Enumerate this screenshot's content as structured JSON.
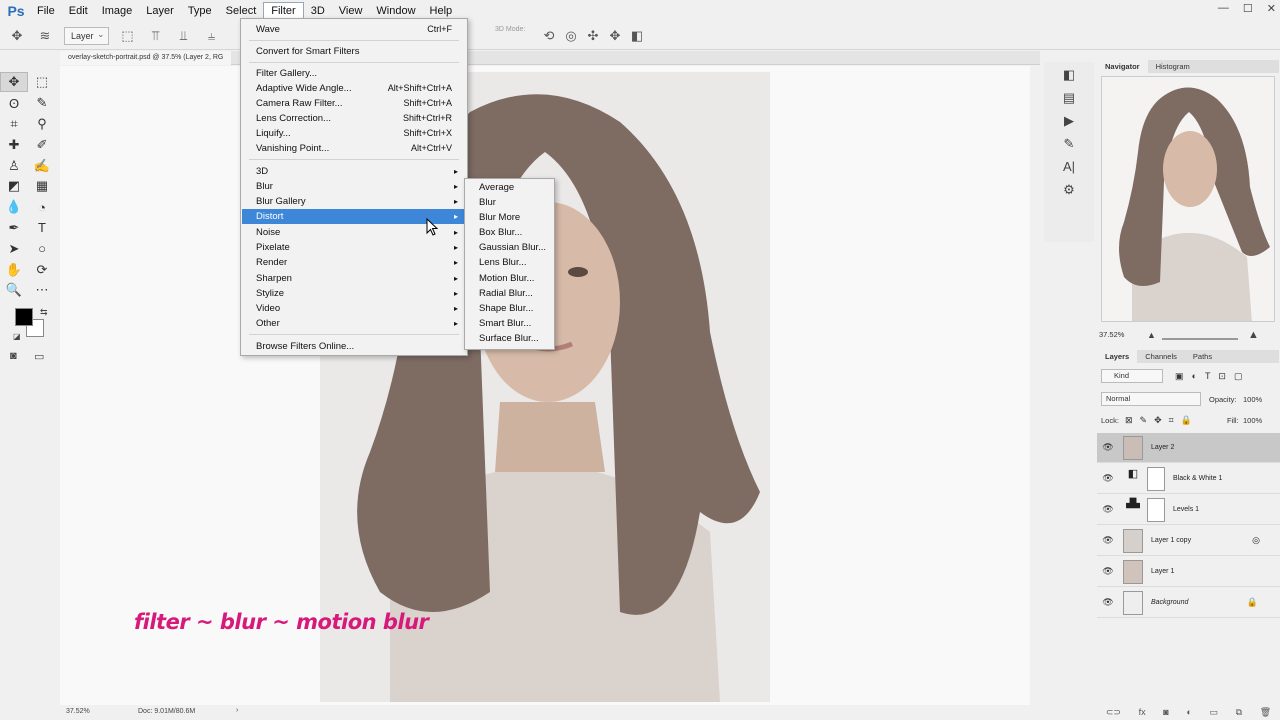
{
  "app": {
    "logo": "Ps"
  },
  "menubar": {
    "items": [
      "File",
      "Edit",
      "Image",
      "Layer",
      "Type",
      "Select",
      "Filter",
      "3D",
      "View",
      "Window",
      "Help"
    ],
    "active": "Filter"
  },
  "window_controls": [
    "—",
    "☐",
    "✕"
  ],
  "options_bar": {
    "layer_select": "Layer",
    "mode_3d": "3D Mode:"
  },
  "document": {
    "tab_title": "overlay-sketch-portrait.psd @ 37.5% (Layer 2, RG"
  },
  "status_bar": {
    "zoom": "37.52%",
    "doc_size": "Doc: 9.01M/80.6M"
  },
  "filter_menu": {
    "items": [
      {
        "label": "Wave",
        "shortcut": "Ctrl+F"
      },
      {
        "label": "Convert for Smart Filters",
        "shortcut": ""
      },
      {
        "label": "Filter Gallery...",
        "shortcut": ""
      },
      {
        "label": "Adaptive Wide Angle...",
        "shortcut": "Alt+Shift+Ctrl+A"
      },
      {
        "label": "Camera Raw Filter...",
        "shortcut": "Shift+Ctrl+A"
      },
      {
        "label": "Lens Correction...",
        "shortcut": "Shift+Ctrl+R"
      },
      {
        "label": "Liquify...",
        "shortcut": "Shift+Ctrl+X"
      },
      {
        "label": "Vanishing Point...",
        "shortcut": "Alt+Ctrl+V"
      },
      {
        "label": "3D",
        "submenu": true
      },
      {
        "label": "Blur",
        "submenu": true
      },
      {
        "label": "Blur Gallery",
        "submenu": true
      },
      {
        "label": "Distort",
        "submenu": true,
        "highlighted": true
      },
      {
        "label": "Noise",
        "submenu": true
      },
      {
        "label": "Pixelate",
        "submenu": true
      },
      {
        "label": "Render",
        "submenu": true
      },
      {
        "label": "Sharpen",
        "submenu": true
      },
      {
        "label": "Stylize",
        "submenu": true
      },
      {
        "label": "Video",
        "submenu": true
      },
      {
        "label": "Other",
        "submenu": true
      },
      {
        "label": "Browse Filters Online...",
        "shortcut": ""
      }
    ]
  },
  "blur_submenu": {
    "items": [
      "Average",
      "Blur",
      "Blur More",
      "Box Blur...",
      "Gaussian Blur...",
      "Lens Blur...",
      "Motion Blur...",
      "Radial Blur...",
      "Shape Blur...",
      "Smart Blur...",
      "Surface Blur..."
    ]
  },
  "navigator": {
    "tabs": [
      "Navigator",
      "Histogram"
    ],
    "zoom": "37.52%"
  },
  "layers_panel": {
    "tabs": [
      "Layers",
      "Channels",
      "Paths"
    ],
    "kind_filter": "Kind",
    "blend_mode": "Normal",
    "opacity_label": "Opacity:",
    "opacity": "100%",
    "lock_label": "Lock:",
    "fill_label": "Fill:",
    "fill": "100%",
    "layers": [
      {
        "name": "Layer 2",
        "selected": true
      },
      {
        "name": "Black & White 1"
      },
      {
        "name": "Levels 1"
      },
      {
        "name": "Layer 1 copy"
      },
      {
        "name": "Layer 1"
      },
      {
        "name": "Background",
        "locked": true
      }
    ]
  },
  "caption": "filter ~ blur ~ motion blur",
  "colors": {
    "highlight": "#3d86d8",
    "caption": "#d6197a",
    "foreground": "#000000",
    "background": "#ffffff"
  }
}
